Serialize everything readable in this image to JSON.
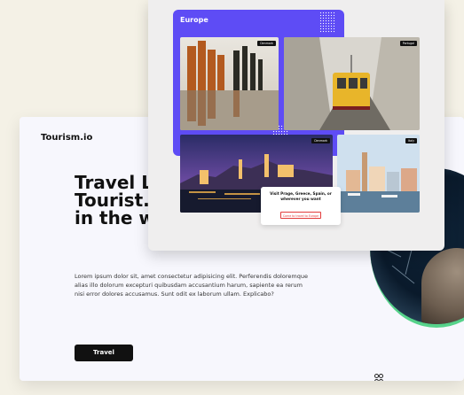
{
  "background": {
    "color": "#f4f1e6"
  },
  "card": {
    "logo": "Tourism.io",
    "headline_lines": [
      "Travel L",
      "Tourist.",
      "in the w"
    ],
    "paragraph": "Lorem ipsum dolor sit, amet consectetur adipisicing elit. Perferendis doloremque alias illo dolorum excepturi quibusdam accusantium harum, sapiente ea rerum nisi error dolores accusamus. Sunt odit ex laborum ullam. Explicabo?",
    "cta_label": "Travel"
  },
  "overlay": {
    "region_label": "Europe",
    "photos": [
      {
        "name": "denmark",
        "tag": "Denmark",
        "icon": "lake-trees-photo"
      },
      {
        "name": "portugal",
        "tag": "Portugal",
        "icon": "tram-street-photo"
      },
      {
        "name": "prague",
        "tag": "Denmark",
        "icon": "castle-night-photo"
      },
      {
        "name": "italy",
        "tag": "Italy",
        "icon": "harbor-town-photo"
      }
    ],
    "tooltip_text": "Visit Prage, Greece, Spain, or wherever you want",
    "tooltip_button": "Come to travel to Europe"
  },
  "colors": {
    "accent": "#5e4cf5",
    "cta": "#111111",
    "ring": "#56d28a",
    "tooltip_button": "#e23b3b"
  }
}
